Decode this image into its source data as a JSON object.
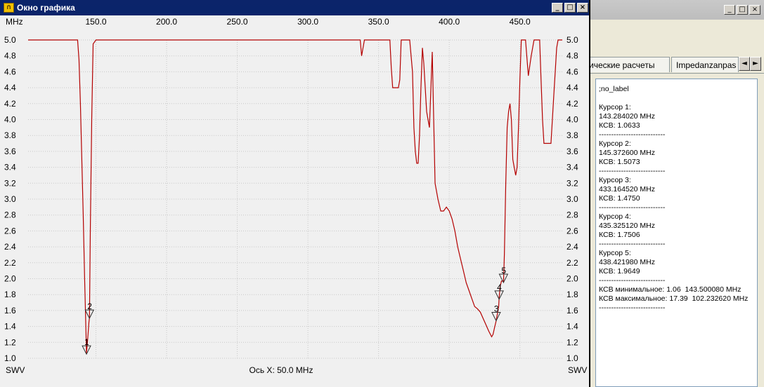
{
  "main_window": {
    "title": "Окно графика",
    "buttons": [
      "_",
      "□",
      "×"
    ]
  },
  "side_window": {
    "buttons": [
      "_",
      "□",
      "×"
    ],
    "tabs": [
      "ические расчеты",
      "Impedanzanpas"
    ],
    "tab_arrows": [
      "◄",
      "►"
    ],
    "info_lines": [
      ";no_label",
      "",
      "Курсор 1:",
      "143.284020 MHz",
      "КСВ: 1.0633",
      "---------------------------",
      "Курсор 2:",
      "145.372600 MHz",
      "КСВ: 1.5073",
      "---------------------------",
      "Курсор 3:",
      "433.164520 MHz",
      "КСВ: 1.4750",
      "---------------------------",
      "Курсор 4:",
      "435.325120 MHz",
      "КСВ: 1.7506",
      "---------------------------",
      "Курсор 5:",
      "438.421980 MHz",
      "КСВ: 1.9649",
      "---------------------------",
      "КСВ минимальное: 1.06  143.500080 MHz",
      "КСВ максимальное: 17.39  102.232620 MHz",
      "---------------------------"
    ]
  },
  "chart_data": {
    "type": "line",
    "x_unit_label": "MHz",
    "y_label_left": "SWV",
    "y_label_right": "SWV",
    "x_axis_caption": "Ось X: 50.0 MHz",
    "xlim": [
      102,
      480
    ],
    "ylim": [
      1.0,
      5.0
    ],
    "x_ticks": [
      "150.0",
      "200.0",
      "250.0",
      "300.0",
      "350.0",
      "400.0",
      "450.0"
    ],
    "x_tick_values": [
      150,
      200,
      250,
      300,
      350,
      400,
      450
    ],
    "y_ticks": [
      "1.0",
      "1.2",
      "1.4",
      "1.6",
      "1.8",
      "2.0",
      "2.2",
      "2.4",
      "2.6",
      "2.8",
      "3.0",
      "3.2",
      "3.4",
      "3.6",
      "3.8",
      "4.0",
      "4.2",
      "4.4",
      "4.6",
      "4.8",
      "5.0"
    ],
    "y_tick_values": [
      1.0,
      1.2,
      1.4,
      1.6,
      1.8,
      2.0,
      2.2,
      2.4,
      2.6,
      2.8,
      3.0,
      3.2,
      3.4,
      3.6,
      3.8,
      4.0,
      4.2,
      4.4,
      4.6,
      4.8,
      5.0
    ],
    "grid": true,
    "line_color": "#b40000",
    "series": [
      {
        "x": [
          102,
          120,
          137,
          138,
          139,
          140,
          141,
          142,
          143,
          143.3,
          144,
          145,
          145.4,
          146,
          147,
          148,
          150,
          200,
          250,
          300,
          337,
          338,
          339,
          340,
          341,
          350,
          355,
          358,
          359,
          360,
          362,
          364,
          365,
          366,
          368,
          370,
          372,
          374,
          375,
          376,
          377,
          378,
          379,
          380,
          381,
          382,
          384,
          386,
          388,
          390,
          392,
          394,
          396,
          398,
          400,
          402,
          404,
          406,
          408,
          410,
          412,
          414,
          416,
          418,
          420,
          422,
          424,
          426,
          428,
          430,
          431,
          432,
          433.2,
          434,
          435,
          435.3,
          436,
          437,
          438,
          438.4,
          439,
          440,
          441,
          442,
          443,
          444,
          445,
          446,
          447,
          448,
          449,
          450,
          451,
          452,
          454,
          456,
          458,
          460,
          462,
          464,
          465,
          466,
          467,
          468,
          469,
          470,
          472,
          474,
          476,
          477,
          478,
          480
        ],
        "y": [
          5.0,
          5.0,
          5.0,
          4.75,
          4.2,
          3.5,
          2.8,
          2.0,
          1.3,
          1.06,
          1.2,
          1.45,
          1.51,
          2.6,
          4.0,
          4.95,
          5.0,
          5.0,
          5.0,
          5.0,
          5.0,
          4.8,
          4.9,
          5.0,
          5.0,
          5.0,
          5.0,
          5.0,
          4.65,
          4.4,
          4.4,
          4.4,
          4.5,
          5.0,
          5.0,
          5.0,
          5.0,
          4.6,
          3.9,
          3.6,
          3.45,
          3.45,
          3.8,
          4.4,
          4.9,
          4.7,
          4.1,
          3.9,
          4.85,
          3.2,
          3.0,
          2.85,
          2.85,
          2.9,
          2.85,
          2.75,
          2.6,
          2.4,
          2.25,
          2.1,
          1.95,
          1.85,
          1.75,
          1.65,
          1.62,
          1.58,
          1.5,
          1.42,
          1.34,
          1.27,
          1.3,
          1.38,
          1.47,
          1.55,
          1.65,
          1.75,
          1.9,
          1.97,
          1.97,
          1.96,
          2.3,
          3.2,
          3.9,
          4.1,
          4.2,
          4.0,
          3.5,
          3.4,
          3.3,
          3.4,
          3.9,
          4.5,
          5.0,
          5.0,
          5.0,
          4.55,
          4.8,
          5.0,
          5.0,
          5.0,
          4.5,
          4.0,
          3.7,
          3.7,
          3.7,
          3.7,
          3.7,
          4.3,
          4.9,
          5.0,
          5.0,
          5.0
        ]
      }
    ],
    "markers": [
      {
        "label": "1",
        "x": 143.3,
        "y": 1.06
      },
      {
        "label": "2",
        "x": 145.4,
        "y": 1.51
      },
      {
        "label": "3",
        "x": 433.2,
        "y": 1.48
      },
      {
        "label": "4",
        "x": 435.3,
        "y": 1.75
      },
      {
        "label": "5",
        "x": 438.4,
        "y": 1.96
      }
    ]
  }
}
